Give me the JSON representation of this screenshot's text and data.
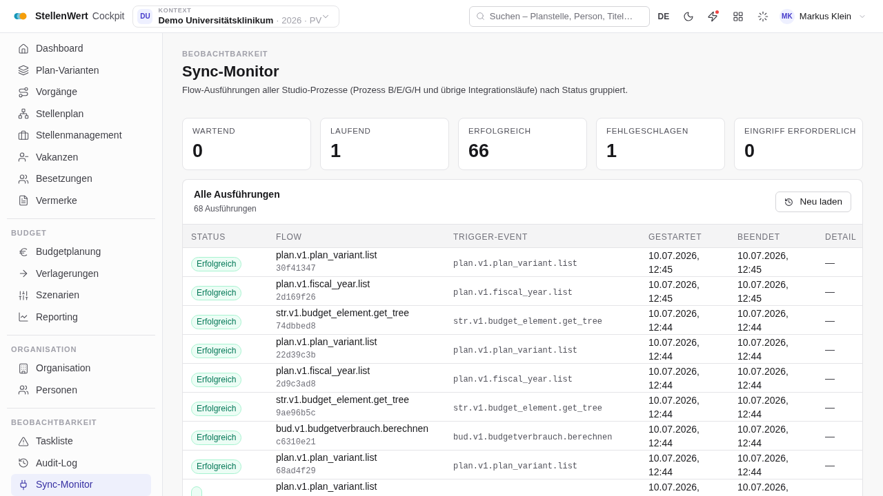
{
  "top_bar": {
    "brand": "StellenWert",
    "product": "Cockpit",
    "context": {
      "initials": "DU",
      "label": "KONTEXT",
      "name": "Demo Universitätsklinikum",
      "detail": "· 2026 · PV"
    },
    "search": {
      "placeholder": "Suchen – Planstelle, Person, Titel…"
    },
    "language": "DE",
    "alerts_unread": true,
    "user": {
      "initials": "MK",
      "name": "Markus Klein"
    }
  },
  "sidebar": {
    "sections": [
      {
        "items": [
          {
            "label": "Dashboard",
            "selected": false
          },
          {
            "label": "Plan-Varianten",
            "selected": false
          },
          {
            "label": "Vorgänge",
            "selected": false
          },
          {
            "label": "Stellenplan",
            "selected": false
          },
          {
            "label": "Stellenmanagement",
            "selected": false
          },
          {
            "label": "Vakanzen",
            "selected": false
          },
          {
            "label": "Besetzungen",
            "selected": false
          },
          {
            "label": "Vermerke",
            "selected": false
          }
        ]
      },
      {
        "title": "BUDGET",
        "items": [
          {
            "label": "Budgetplanung",
            "selected": false
          },
          {
            "label": "Verlagerungen",
            "selected": false
          },
          {
            "label": "Szenarien",
            "selected": false
          },
          {
            "label": "Reporting",
            "selected": false
          }
        ]
      },
      {
        "title": "ORGANISATION",
        "items": [
          {
            "label": "Organisation",
            "selected": false
          },
          {
            "label": "Personen",
            "selected": false
          }
        ]
      },
      {
        "title": "BEOBACHTBARKEIT",
        "items": [
          {
            "label": "Taskliste",
            "selected": false
          },
          {
            "label": "Audit-Log",
            "selected": false
          },
          {
            "label": "Sync-Monitor",
            "selected": true
          }
        ]
      }
    ]
  },
  "header": {
    "eyebrow": "BEOBACHTBARKEIT",
    "title": "Sync-Monitor",
    "description": "Flow-Ausführungen aller Studio-Prozesse (Prozess B/E/G/H und übrige Integrationsläufe) nach Status gruppiert."
  },
  "stats": [
    {
      "label": "WARTEND",
      "value": "0"
    },
    {
      "label": "LAUFEND",
      "value": "1"
    },
    {
      "label": "ERFOLGREICH",
      "value": "66"
    },
    {
      "label": "FEHLGESCHLAGEN",
      "value": "1"
    },
    {
      "label": "EINGRIFF ERFORDERLICH",
      "value": "0"
    }
  ],
  "runs": {
    "title": "Alle Ausführungen",
    "count": "68 Ausführungen",
    "reload_button": "Neu laden",
    "table": {
      "columns": [
        "STATUS",
        "FLOW",
        "TRIGGER-EVENT",
        "GESTARTET",
        "BEENDET",
        "DETAIL"
      ],
      "rows": [
        {
          "status": {
            "label": "Erfolgreich",
            "kind": "success"
          },
          "flow": "plan.v1.plan_variant.list",
          "run_id": "30f41347",
          "trigger": "plan.v1.plan_variant.list",
          "started": "10.07.2026, 12:45",
          "ended": "10.07.2026, 12:45",
          "detail": "—"
        },
        {
          "status": {
            "label": "Erfolgreich",
            "kind": "success"
          },
          "flow": "plan.v1.fiscal_year.list",
          "run_id": "2d169f26",
          "trigger": "plan.v1.fiscal_year.list",
          "started": "10.07.2026, 12:45",
          "ended": "10.07.2026, 12:45",
          "detail": "—"
        },
        {
          "status": {
            "label": "Erfolgreich",
            "kind": "success"
          },
          "flow": "str.v1.budget_element.get_tree",
          "run_id": "74dbbed8",
          "trigger": "str.v1.budget_element.get_tree",
          "started": "10.07.2026, 12:44",
          "ended": "10.07.2026, 12:44",
          "detail": "—"
        },
        {
          "status": {
            "label": "Erfolgreich",
            "kind": "success"
          },
          "flow": "plan.v1.plan_variant.list",
          "run_id": "22d39c3b",
          "trigger": "plan.v1.plan_variant.list",
          "started": "10.07.2026, 12:44",
          "ended": "10.07.2026, 12:44",
          "detail": "—"
        },
        {
          "status": {
            "label": "Erfolgreich",
            "kind": "success"
          },
          "flow": "plan.v1.fiscal_year.list",
          "run_id": "2d9c3ad8",
          "trigger": "plan.v1.fiscal_year.list",
          "started": "10.07.2026, 12:44",
          "ended": "10.07.2026, 12:44",
          "detail": "—"
        },
        {
          "status": {
            "label": "Erfolgreich",
            "kind": "success"
          },
          "flow": "str.v1.budget_element.get_tree",
          "run_id": "9ae96b5c",
          "trigger": "str.v1.budget_element.get_tree",
          "started": "10.07.2026, 12:44",
          "ended": "10.07.2026, 12:44",
          "detail": "—"
        },
        {
          "status": {
            "label": "Erfolgreich",
            "kind": "success"
          },
          "flow": "bud.v1.budgetverbrauch.berechnen",
          "run_id": "c6310e21",
          "trigger": "bud.v1.budgetverbrauch.berechnen",
          "started": "10.07.2026, 12:44",
          "ended": "10.07.2026, 12:44",
          "detail": "—"
        },
        {
          "status": {
            "label": "Erfolgreich",
            "kind": "success"
          },
          "flow": "plan.v1.plan_variant.list",
          "run_id": "68ad4f29",
          "trigger": "plan.v1.plan_variant.list",
          "started": "10.07.2026, 12:44",
          "ended": "10.07.2026, 12:44",
          "detail": "—"
        },
        {
          "status": {
            "kind": "success"
          },
          "flow": "plan.v1.plan_variant.list",
          "started": "10.07.2026,",
          "ended": "10.07.2026,"
        }
      ]
    }
  }
}
